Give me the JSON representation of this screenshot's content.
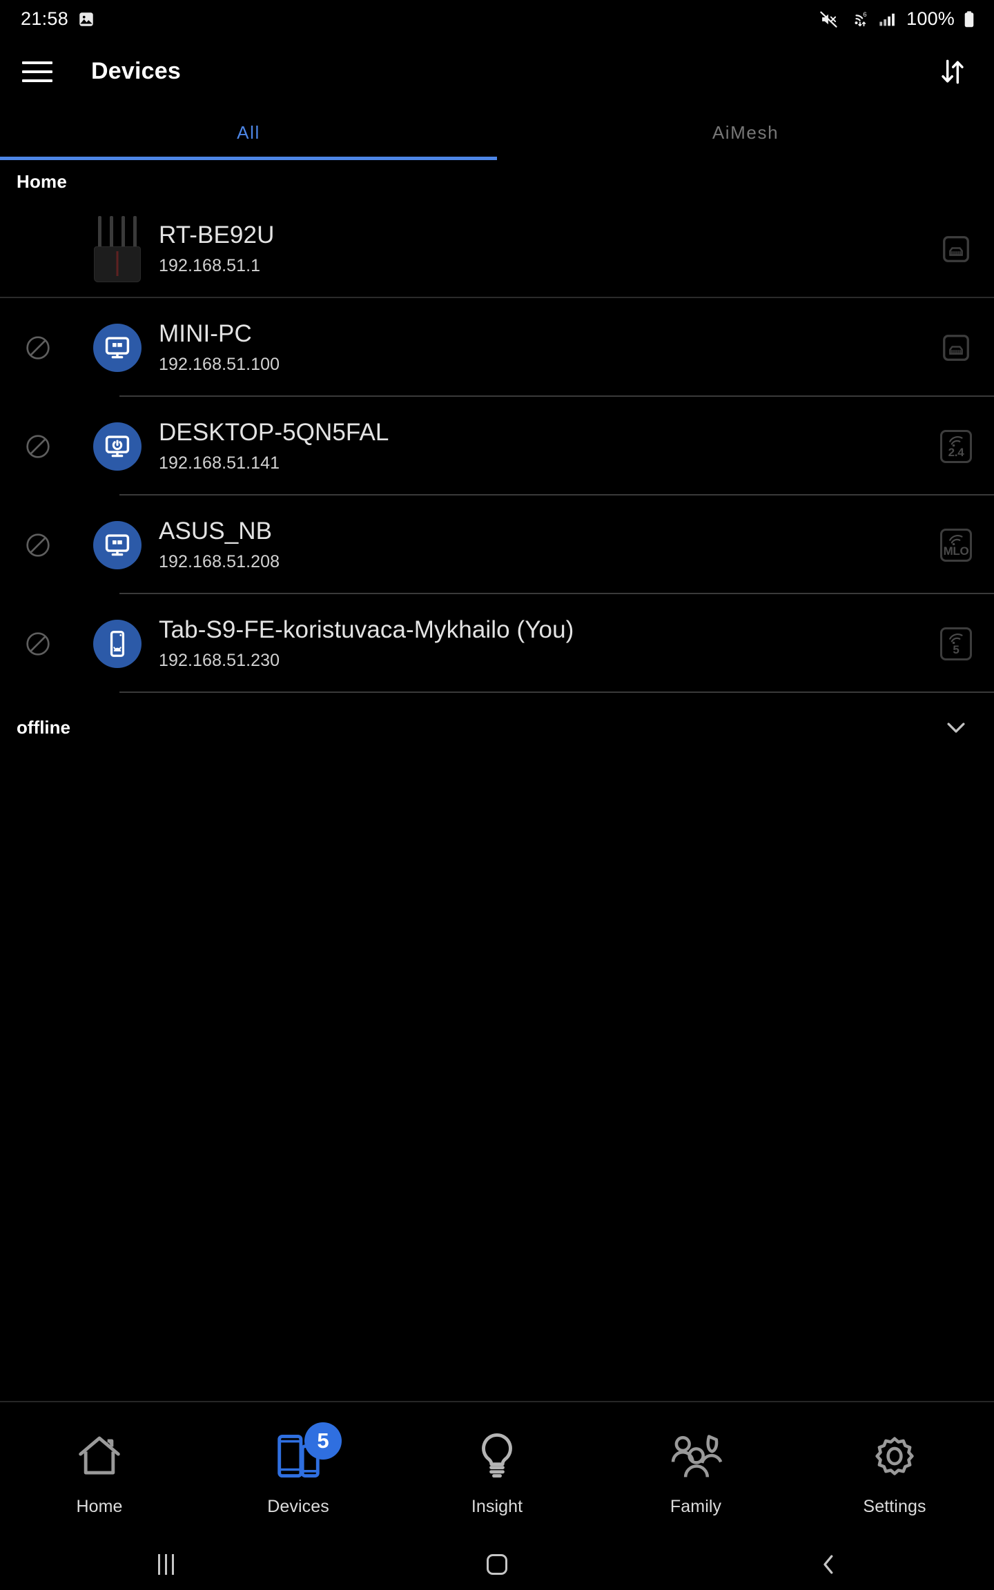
{
  "statusbar": {
    "time": "21:58",
    "image_icon": "image-icon",
    "mute_icon": "mute-icon",
    "wifi_icon": "wifi-6-icon",
    "signal_icon": "cellular-signal-icon",
    "battery_text": "100%",
    "battery_icon": "battery-full-icon"
  },
  "appbar": {
    "menu_icon": "hamburger-menu-icon",
    "title": "Devices",
    "sort_icon": "sort-arrows-icon"
  },
  "tabs": {
    "items": [
      {
        "label": "All",
        "active": true
      },
      {
        "label": "AiMesh",
        "active": false
      }
    ],
    "accent_color": "#4d86e6",
    "inactive_color": "#777777"
  },
  "sections": {
    "online": {
      "header": "Home",
      "devices": [
        {
          "name": "RT-BE92U",
          "ip": "192.168.51.1",
          "avatar": "router-image",
          "connection": "ethernet-icon",
          "connection_label": "",
          "blockable": false
        },
        {
          "name": "MINI-PC",
          "ip": "192.168.51.100",
          "avatar": "windows-desktop-icon",
          "connection": "ethernet-icon",
          "connection_label": "",
          "blockable": true
        },
        {
          "name": "DESKTOP-5QN5FAL",
          "ip": "192.168.51.141",
          "avatar": "desktop-power-icon",
          "connection": "wifi-band-icon",
          "connection_label": "2.4",
          "blockable": true
        },
        {
          "name": "ASUS_NB",
          "ip": "192.168.51.208",
          "avatar": "windows-desktop-icon",
          "connection": "wifi-band-icon",
          "connection_label": "MLO",
          "blockable": true
        },
        {
          "name": "Tab-S9-FE-koristuvaca-Mykhailo (You)",
          "ip": "192.168.51.230",
          "avatar": "android-tablet-icon",
          "connection": "wifi-band-icon",
          "connection_label": "5",
          "blockable": true
        }
      ]
    },
    "offline": {
      "header": "offline",
      "expand_icon": "chevron-down-icon"
    }
  },
  "bottomnav": {
    "items": [
      {
        "label": "Home",
        "icon": "home-icon",
        "active": false,
        "badge": ""
      },
      {
        "label": "Devices",
        "icon": "devices-icon",
        "active": true,
        "badge": "5"
      },
      {
        "label": "Insight",
        "icon": "bulb-icon",
        "active": false,
        "badge": ""
      },
      {
        "label": "Family",
        "icon": "people-icon",
        "active": false,
        "badge": ""
      },
      {
        "label": "Settings",
        "icon": "gear-icon",
        "active": false,
        "badge": ""
      }
    ],
    "active_color": "#2f6fe0"
  },
  "sysnav": {
    "recents": "recent-apps-icon",
    "home": "home-square-icon",
    "back": "back-chevron-icon"
  }
}
